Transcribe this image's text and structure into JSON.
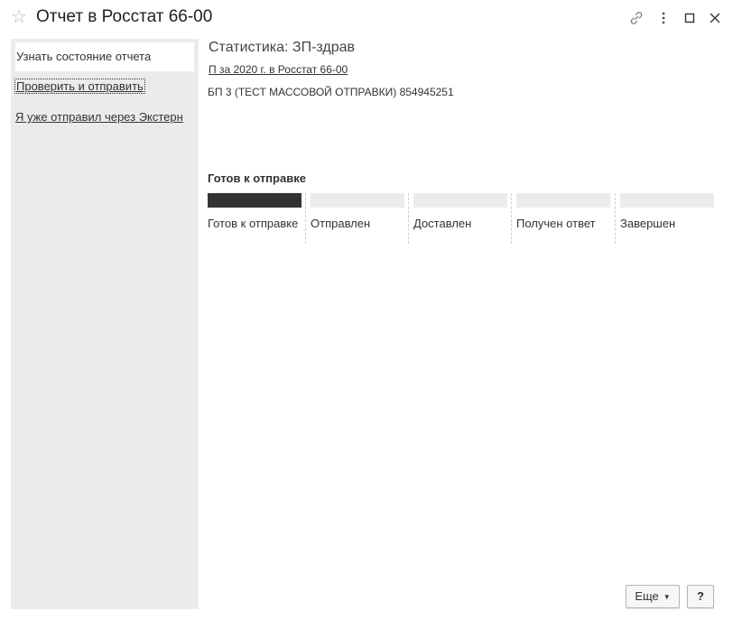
{
  "window": {
    "title": "Отчет в Росстат 66-00",
    "favorite_icon": "star-outline-icon",
    "link_icon": "link-icon",
    "menu_icon": "vertical-dots-icon",
    "maximize_icon": "maximize-icon",
    "close_icon": "close-icon"
  },
  "sidebar": {
    "command": "Узнать состояние отчета",
    "links": [
      "Проверить и отправить",
      "Я уже отправил через Экстерн"
    ]
  },
  "report": {
    "title": "Статистика: ЗП-здрав",
    "period_link": "П за 2020 г. в Росстат 66-00",
    "organization": "БП 3 (ТЕСТ МАССОВОЙ ОТПРАВКИ) 854945251"
  },
  "status": {
    "heading": "Готов к отправке",
    "current_stage": 1,
    "stages": [
      "Готов к отправке",
      "Отправлен",
      "Доставлен",
      "Получен ответ",
      "Завершен"
    ],
    "active_color": "#333333",
    "inactive_color": "#ebebeb"
  },
  "footer": {
    "more_label": "Еще",
    "help_label": "?"
  }
}
